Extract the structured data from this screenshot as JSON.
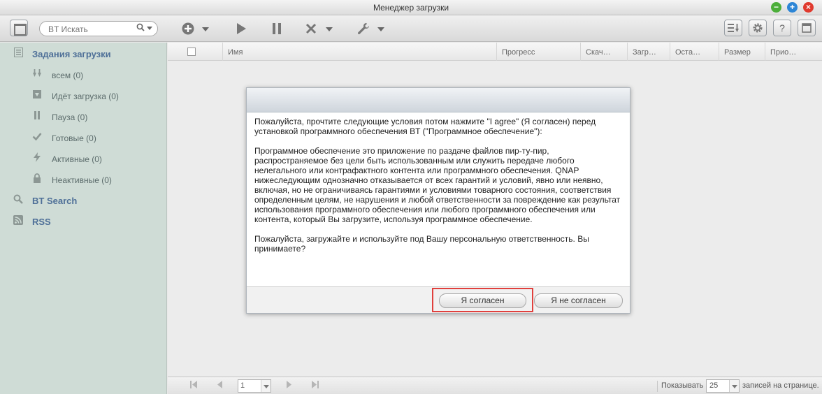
{
  "window": {
    "title": "Менеджер загрузки",
    "min_symbol": "−",
    "max_symbol": "+",
    "close_symbol": "×"
  },
  "toolbar": {
    "search_placeholder": "BT Искать",
    "add_icon": "plus-circle-icon",
    "start_icon": "play-icon",
    "pause_icon": "pause-icon",
    "stop_icon": "x-icon",
    "settings_icon": "wrench-icon",
    "right_buttons": [
      "sort-icon",
      "gear-icon",
      "help-icon",
      "panel-icon"
    ],
    "help_symbol": "?"
  },
  "sidebar": {
    "header_tasks": "Задания загрузки",
    "items": [
      {
        "label": "всем (0)",
        "icon": "download-arrows-icon"
      },
      {
        "label": "Идёт загрузка (0)",
        "icon": "download-box-icon"
      },
      {
        "label": "Пауза (0)",
        "icon": "pause-icon"
      },
      {
        "label": "Готовые (0)",
        "icon": "check-icon"
      },
      {
        "label": "Активные (0)",
        "icon": "lightning-icon"
      },
      {
        "label": "Неактивные (0)",
        "icon": "lock-icon"
      }
    ],
    "bt_search": "BT Search",
    "rss": "RSS"
  },
  "grid": {
    "columns": [
      "Имя",
      "Прогресс",
      "Скач…",
      "Загр…",
      "Оста…",
      "Размер",
      "Прио…"
    ]
  },
  "pager": {
    "page": "1",
    "show_label": "Показывать",
    "page_size": "25",
    "per_page_label": "записей на странице."
  },
  "dialog": {
    "paragraphs": [
      "Пожалуйста, прочтите следующие условия потом нажмите \"I agree\" (Я согласен) перед установкой программного обеспечения BT (\"Программное обеспечение\"):",
      "Программное обеспечение это приложение по раздаче файлов пир-ту-пир, распространяемое без цели быть использованным или служить передаче любого нелегального или контрафактного контента или программного обеспечения. QNAP нижеследующим однозначно отказывается от всех гарантий и условий, явно или неявно, включая, но не ограничиваясь гарантиями и условиями товарного состояния, соответствия определенным целям, не нарушения и любой ответственности за повреждение как результат использования программного обеспечения или любого программного обеспечения или контента, который Вы загрузите, используя программное обеспечение.",
      "Пожалуйста, загружайте и используйте под Вашу персональную ответственность. Вы принимаете?"
    ],
    "agree_label": "Я согласен",
    "disagree_label": "Я не согласен"
  },
  "colors": {
    "sidebar_bg": "#cfdcd6",
    "sidebar_header": "#4f7098",
    "highlight": "#e0403d"
  }
}
